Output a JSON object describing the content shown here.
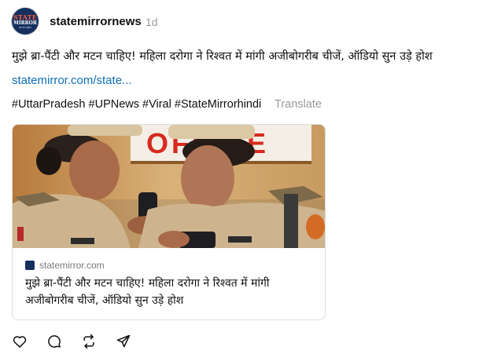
{
  "post": {
    "avatar": {
      "line1": "STATE",
      "line2": "MIRROR",
      "line3": "सच का आईना"
    },
    "username": "statemirrornews",
    "time": "1d",
    "text": "मुझे ब्रा-पैंटी और मटन चाहिए! महिला दरोगा ने रिश्वत में मांगी अजीबोगरीब चीजें, ऑडियो सुन उड़े होश",
    "link": "statemirror.com/state...",
    "hashtags": [
      "#UttarPradesh",
      "#UPNews",
      "#Viral",
      "#StateMirrorhindi"
    ],
    "translate": "Translate"
  },
  "card": {
    "image_text": "OFFICE",
    "site": "statemirror.com",
    "title": "मुझे ब्रा-पैंटी और मटन चाहिए! महिला दरोगा ने रिश्वत में मांगी अजीबोगरीब चीजें, ऑडियो सुन उड़े होश"
  },
  "actions": {
    "icons": [
      "heart-icon",
      "comment-icon",
      "repost-icon",
      "share-icon"
    ]
  },
  "colors": {
    "link": "#0f6fb8",
    "muted": "#999999",
    "uniform": "#cdb48e",
    "sign_red": "#d72a1f",
    "brand_navy": "#15305f"
  }
}
